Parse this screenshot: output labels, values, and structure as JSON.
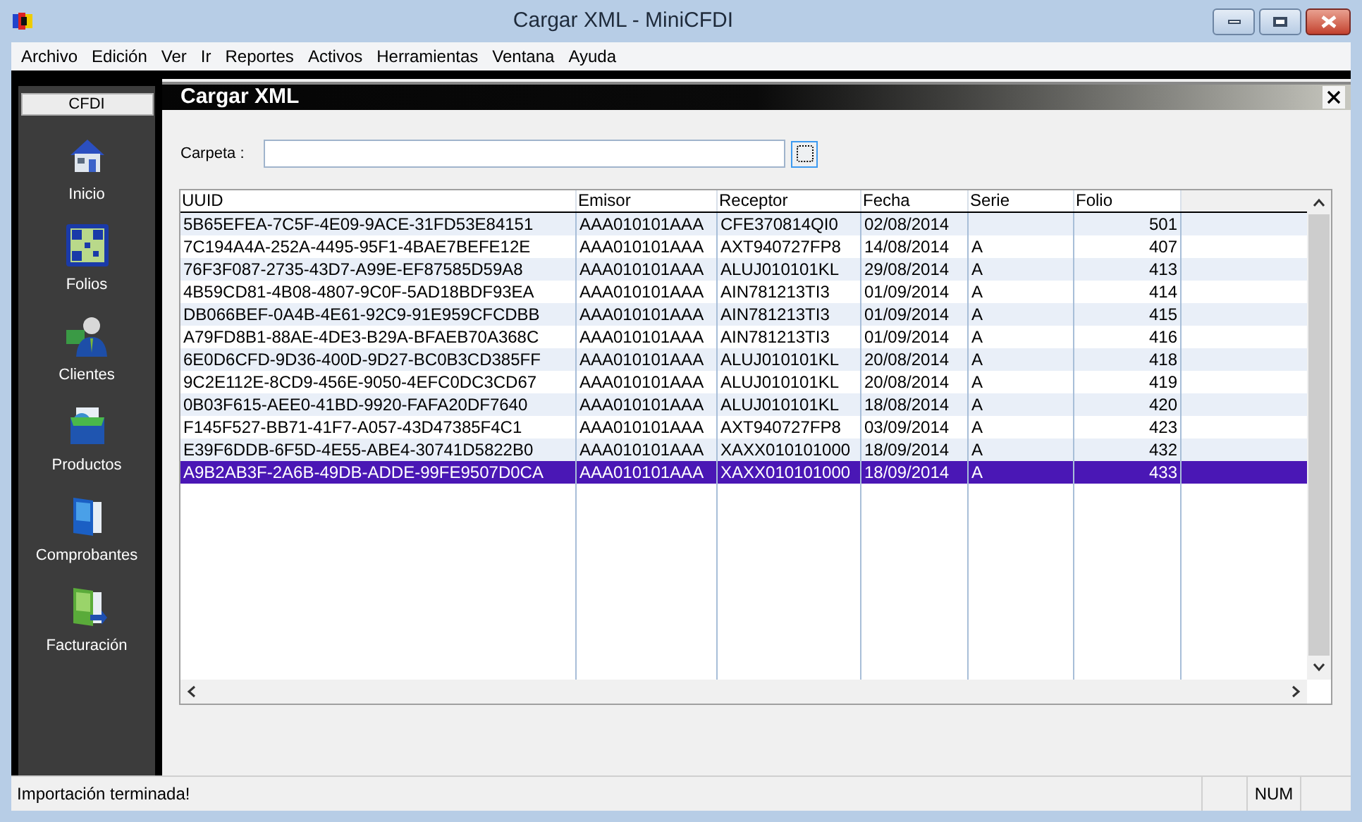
{
  "window": {
    "title": "Cargar XML - MiniCFDI"
  },
  "menu": [
    "Archivo",
    "Edición",
    "Ver",
    "Ir",
    "Reportes",
    "Activos",
    "Herramientas",
    "Ventana",
    "Ayuda"
  ],
  "sidebar": {
    "header": "CFDI",
    "items": [
      {
        "label": "Inicio",
        "kind": "home"
      },
      {
        "label": "Folios",
        "kind": "qr"
      },
      {
        "label": "Clientes",
        "kind": "person"
      },
      {
        "label": "Productos",
        "kind": "box"
      },
      {
        "label": "Comprobantes",
        "kind": "folder"
      },
      {
        "label": "Facturación",
        "kind": "invoice"
      }
    ]
  },
  "child_window": {
    "title": "Cargar XML"
  },
  "folder_field": {
    "label": "Carpeta :"
  },
  "table": {
    "columns": [
      "UUID",
      "Emisor",
      "Receptor",
      "Fecha",
      "Serie",
      "Folio"
    ],
    "rows": [
      {
        "cells": [
          "5B65EFEA-7C5F-4E09-9ACE-31FD53E84151",
          "AAA010101AAA",
          "CFE370814QI0",
          "02/08/2014",
          "",
          "501"
        ],
        "selected": false
      },
      {
        "cells": [
          "7C194A4A-252A-4495-95F1-4BAE7BEFE12E",
          "AAA010101AAA",
          "AXT940727FP8",
          "14/08/2014",
          "A",
          "407"
        ],
        "selected": false
      },
      {
        "cells": [
          "76F3F087-2735-43D7-A99E-EF87585D59A8",
          "AAA010101AAA",
          "ALUJ010101KL",
          "29/08/2014",
          "A",
          "413"
        ],
        "selected": false
      },
      {
        "cells": [
          "4B59CD81-4B08-4807-9C0F-5AD18BDF93EA",
          "AAA010101AAA",
          "AIN781213TI3",
          "01/09/2014",
          "A",
          "414"
        ],
        "selected": false
      },
      {
        "cells": [
          "DB066BEF-0A4B-4E61-92C9-91E959CFCDBB",
          "AAA010101AAA",
          "AIN781213TI3",
          "01/09/2014",
          "A",
          "415"
        ],
        "selected": false
      },
      {
        "cells": [
          "A79FD8B1-88AE-4DE3-B29A-BFAEB70A368C",
          "AAA010101AAA",
          "AIN781213TI3",
          "01/09/2014",
          "A",
          "416"
        ],
        "selected": false
      },
      {
        "cells": [
          "6E0D6CFD-9D36-400D-9D27-BC0B3CD385FF",
          "AAA010101AAA",
          "ALUJ010101KL",
          "20/08/2014",
          "A",
          "418"
        ],
        "selected": false
      },
      {
        "cells": [
          "9C2E112E-8CD9-456E-9050-4EFC0DC3CD67",
          "AAA010101AAA",
          "ALUJ010101KL",
          "20/08/2014",
          "A",
          "419"
        ],
        "selected": false
      },
      {
        "cells": [
          "0B03F615-AEE0-41BD-9920-FAFA20DF7640",
          "AAA010101AAA",
          "ALUJ010101KL",
          "18/08/2014",
          "A",
          "420"
        ],
        "selected": false
      },
      {
        "cells": [
          "F145F527-BB71-41F7-A057-43D47385F4C1",
          "AAA010101AAA",
          "AXT940727FP8",
          "03/09/2014",
          "A",
          "423"
        ],
        "selected": false
      },
      {
        "cells": [
          "E39F6DDB-6F5D-4E55-ABE4-30741D5822B0",
          "AAA010101AAA",
          "XAXX010101000",
          "18/09/2014",
          "A",
          "432"
        ],
        "selected": false
      },
      {
        "cells": [
          "A9B2AB3F-2A6B-49DB-ADDE-99FE9507D0CA",
          "AAA010101AAA",
          "XAXX010101000",
          "18/09/2014",
          "A",
          "433"
        ],
        "selected": true
      }
    ]
  },
  "status_bar": {
    "message": "Importación terminada!",
    "indicator": "NUM"
  }
}
